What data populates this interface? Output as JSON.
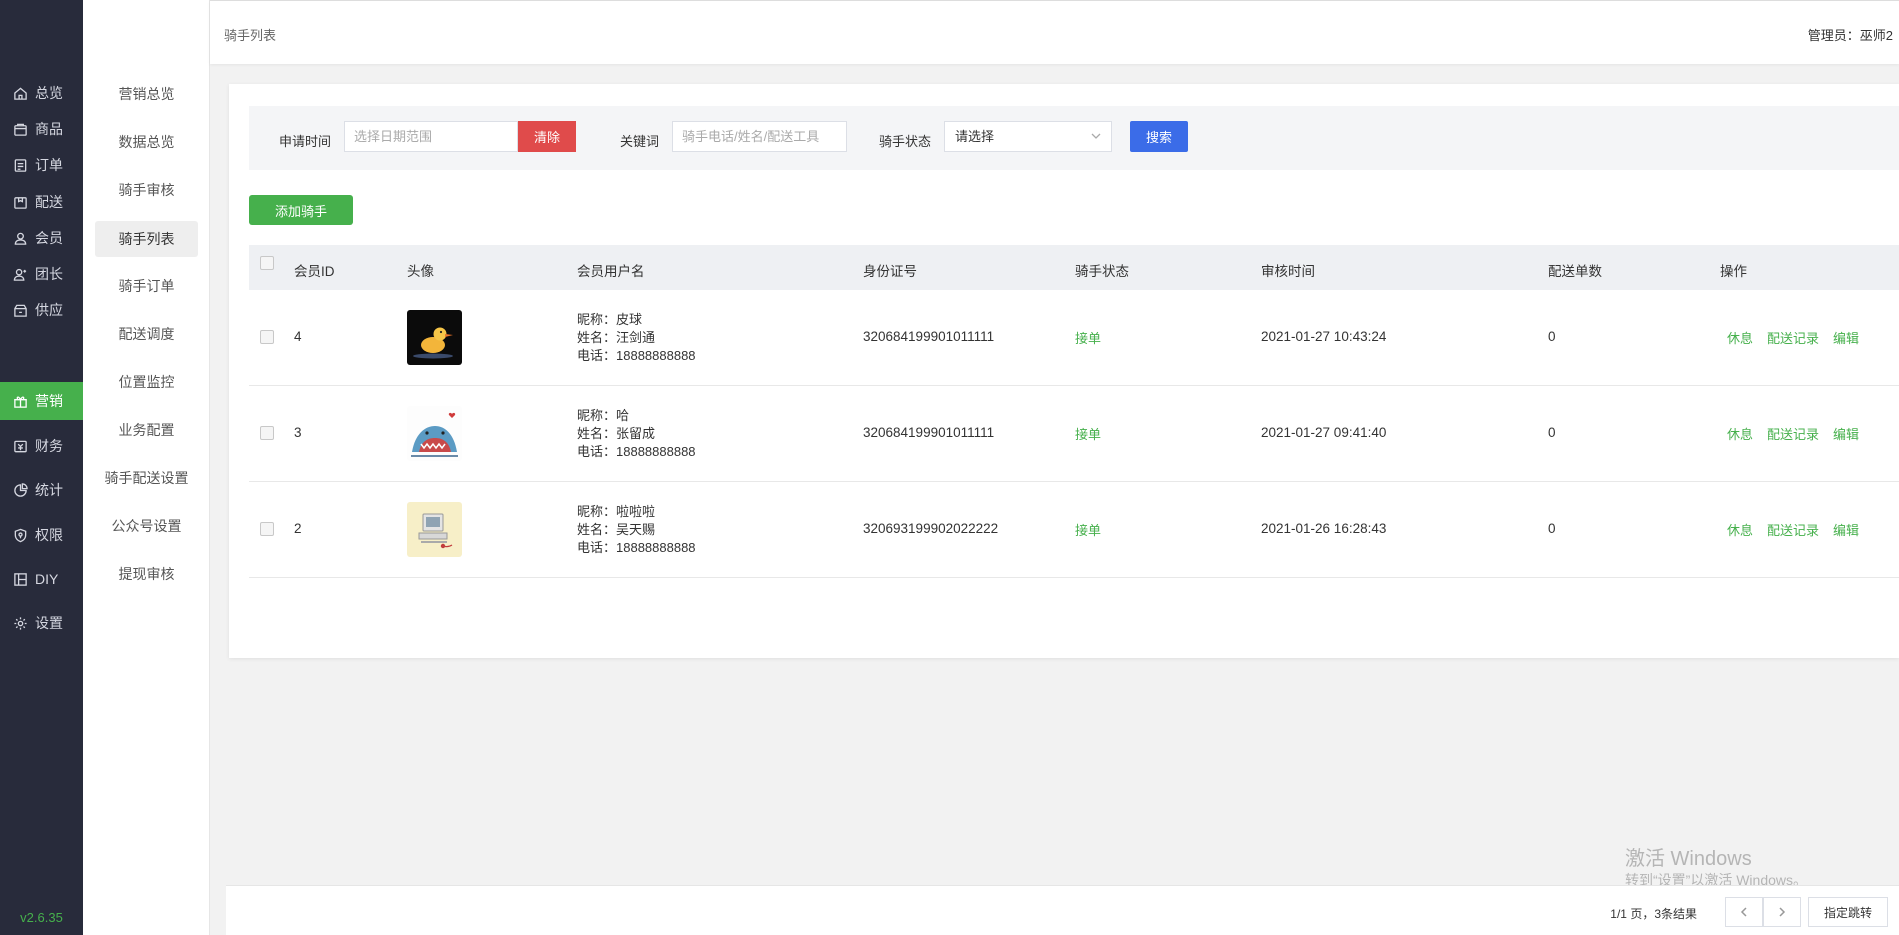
{
  "app": {
    "version": "v2.6.35"
  },
  "nav": {
    "items": [
      {
        "label": "总览",
        "icon": "home-icon"
      },
      {
        "label": "商品",
        "icon": "goods-icon"
      },
      {
        "label": "订单",
        "icon": "order-icon"
      },
      {
        "label": "配送",
        "icon": "delivery-icon"
      },
      {
        "label": "会员",
        "icon": "member-icon"
      },
      {
        "label": "团长",
        "icon": "leader-icon"
      },
      {
        "label": "供应",
        "icon": "supply-icon"
      },
      {
        "label": "营销",
        "icon": "gift-icon",
        "active": true
      },
      {
        "label": "财务",
        "icon": "finance-icon"
      },
      {
        "label": "统计",
        "icon": "pie-chart-icon"
      },
      {
        "label": "权限",
        "icon": "shield-icon"
      },
      {
        "label": "DIY",
        "icon": "layout-icon"
      },
      {
        "label": "设置",
        "icon": "gear-icon"
      }
    ]
  },
  "subnav": {
    "items": [
      {
        "label": "营销总览"
      },
      {
        "label": "数据总览"
      },
      {
        "label": "骑手审核"
      },
      {
        "label": "骑手列表",
        "active": true
      },
      {
        "label": "骑手订单"
      },
      {
        "label": "配送调度"
      },
      {
        "label": "位置监控"
      },
      {
        "label": "业务配置"
      },
      {
        "label": "骑手配送设置"
      },
      {
        "label": "公众号设置"
      },
      {
        "label": "提现审核"
      }
    ]
  },
  "header": {
    "breadcrumb": "骑手列表",
    "admin_label": "管理员：",
    "admin_name": "巫师2"
  },
  "filter": {
    "date_label": "申请时间",
    "date_placeholder": "选择日期范围",
    "clear_button": "清除",
    "keyword_label": "关键词",
    "keyword_placeholder": "骑手电话/姓名/配送工具",
    "status_label": "骑手状态",
    "status_value": "请选择",
    "search_button": "搜索"
  },
  "add_button": "添加骑手",
  "table": {
    "columns": [
      "会员ID",
      "头像",
      "会员用户名",
      "身份证号",
      "骑手状态",
      "审核时间",
      "配送单数",
      "操作"
    ],
    "rows": [
      {
        "id": "4",
        "nickname": "昵称：皮球",
        "name": "姓名：汪剑通",
        "phone": "电话：18888888888",
        "idcard": "320684199901011111",
        "status": "接单",
        "time": "2021-01-27 10:43:24",
        "count": "0",
        "avatar": "duck-avatar"
      },
      {
        "id": "3",
        "nickname": "昵称：哈",
        "name": "姓名：张留成",
        "phone": "电话：18888888888",
        "idcard": "320684199901011111",
        "status": "接单",
        "time": "2021-01-27 09:41:40",
        "count": "0",
        "avatar": "shark-avatar"
      },
      {
        "id": "2",
        "nickname": "昵称：啦啦啦",
        "name": "姓名：吴天赐",
        "phone": "电话：18888888888",
        "idcard": "320693199902022222",
        "status": "接单",
        "time": "2021-01-26 16:28:43",
        "count": "0",
        "avatar": "computer-avatar"
      }
    ],
    "actions": {
      "rest": "休息",
      "records": "配送记录",
      "edit": "编辑"
    }
  },
  "pagination": {
    "info": "1/1 页，3条结果",
    "jump": "指定跳转"
  },
  "watermark": {
    "line1": "激活 Windows",
    "line2": "转到“设置”以激活 Windows。"
  },
  "colors": {
    "nav_bg": "#282b3b",
    "accent_green": "#46b04c",
    "danger": "#e04b4b",
    "primary_blue": "#3b6ce8"
  }
}
